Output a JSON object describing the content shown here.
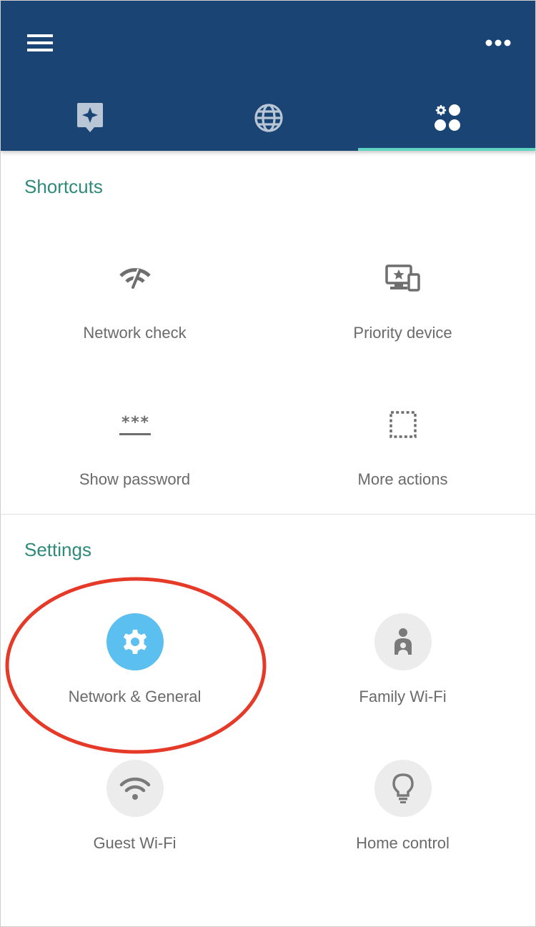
{
  "header": {
    "menu_icon": "hamburger-menu-icon",
    "more_icon": "more-horizontal-icon",
    "tabs": [
      {
        "id": "shortcuts",
        "icon": "sparkle-tag-icon",
        "active": false
      },
      {
        "id": "network",
        "icon": "globe-icon",
        "active": false
      },
      {
        "id": "settings",
        "icon": "settings-dots-icon",
        "active": true
      }
    ],
    "colors": {
      "bar": "#1a4474",
      "indicator": "#5fd4bf"
    }
  },
  "shortcuts": {
    "title": "Shortcuts",
    "items": [
      {
        "label": "Network check",
        "icon": "wifi-speed-icon"
      },
      {
        "label": "Priority device",
        "icon": "priority-device-icon"
      },
      {
        "label": "Show password",
        "icon": "password-icon"
      },
      {
        "label": "More actions",
        "icon": "dashed-square-icon"
      }
    ]
  },
  "settings": {
    "title": "Settings",
    "items": [
      {
        "label": "Network & General",
        "icon": "gear-icon",
        "highlighted": true
      },
      {
        "label": "Family Wi-Fi",
        "icon": "family-person-icon"
      },
      {
        "label": "Guest Wi-Fi",
        "icon": "wifi-icon"
      },
      {
        "label": "Home control",
        "icon": "lightbulb-icon"
      }
    ]
  },
  "colors": {
    "section_title": "#2f8a7c",
    "label": "#6a6a6a",
    "active_circle": "#5bbff0",
    "annotation": "#e53a28"
  }
}
